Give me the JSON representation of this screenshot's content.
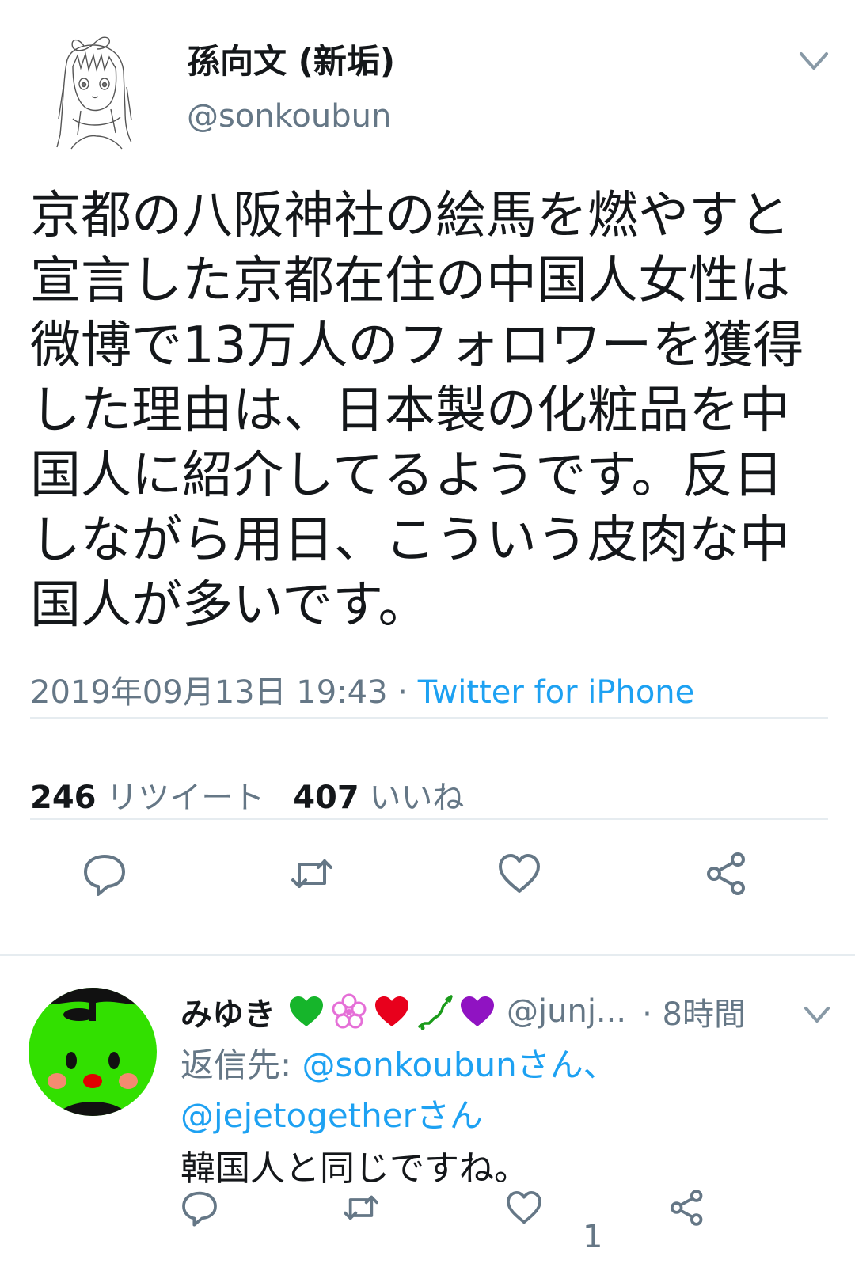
{
  "tweet": {
    "display_name": "孫向文 (新垢)",
    "handle": "@sonkoubun",
    "text_lines": [
      "京都の八阪神社の絵馬を燃やすと",
      "宣言した京都在住の中国人女性は",
      "微博で13万人のフォロワーを獲得",
      "した理由は、日本製の化粧品を中",
      "国人に紹介してるようです。反日",
      "しながら用日、こういう皮肉な中",
      "国人が多いです。"
    ],
    "timestamp": "2019年09月13日 19:43",
    "separator": " · ",
    "source": "Twitter for iPhone",
    "retweet_count": "246",
    "retweet_label": "リツイート",
    "like_count": "407",
    "like_label": "いいね",
    "icons": {
      "reply": "reply-icon",
      "retweet": "retweet-icon",
      "like": "heart-icon",
      "share": "share-icon",
      "menu": "chevron-down-icon"
    }
  },
  "reply": {
    "display_name": "みゆき",
    "emojis": [
      "green-heart",
      "pink-flower",
      "red-heart",
      "japan-map",
      "purple-heart"
    ],
    "handle": "@junj...",
    "time": "· 8時間",
    "reply_to_label": "返信先: ",
    "mention1": "@sonkoubun",
    "san1": "さん、",
    "mention2": "@jejetogether",
    "san2": "さん",
    "text": "韓国人と同じですね。",
    "like_count": "1"
  },
  "colors": {
    "link": "#1da1f2",
    "secondary": "#657786",
    "text": "#14171a",
    "divider": "#e6ecf0"
  }
}
